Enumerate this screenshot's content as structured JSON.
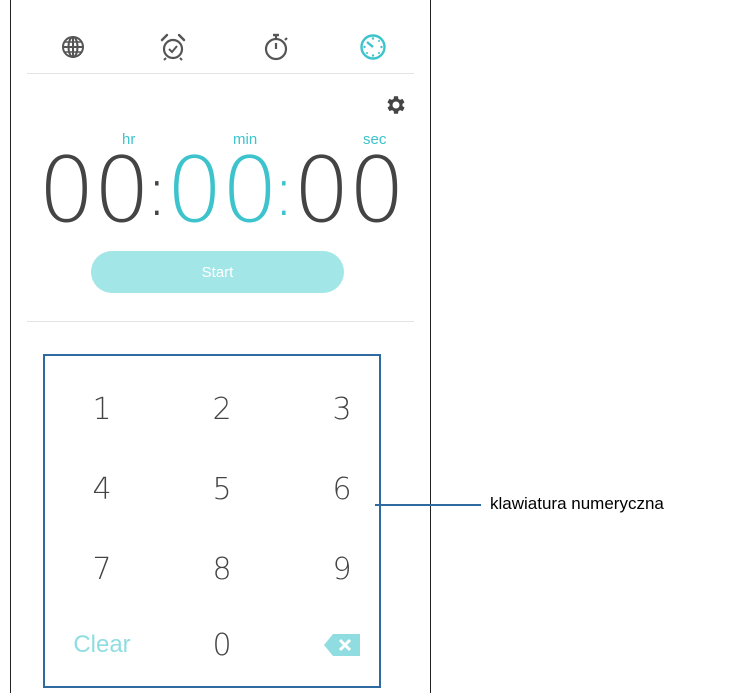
{
  "tabs": [
    {
      "icon": "globe-icon",
      "active": false
    },
    {
      "icon": "alarm-icon",
      "active": false
    },
    {
      "icon": "stopwatch-icon",
      "active": false
    },
    {
      "icon": "timer-icon",
      "active": true
    }
  ],
  "colors": {
    "accent": "#3cc3cc",
    "start_button": "#a3e6e7",
    "callout": "#2e6aa0",
    "text": "#444444"
  },
  "timer": {
    "unit_hr": "hr",
    "unit_min": "min",
    "unit_sec": "sec",
    "hours": "00",
    "minutes": "00",
    "seconds": "00",
    "separator": ":"
  },
  "start_label": "Start",
  "keypad": {
    "k1": "1",
    "k2": "2",
    "k3": "3",
    "k4": "4",
    "k5": "5",
    "k6": "6",
    "k7": "7",
    "k8": "8",
    "k9": "9",
    "clear": "Clear",
    "k0": "0"
  },
  "callout": "klawiatura numeryczna"
}
